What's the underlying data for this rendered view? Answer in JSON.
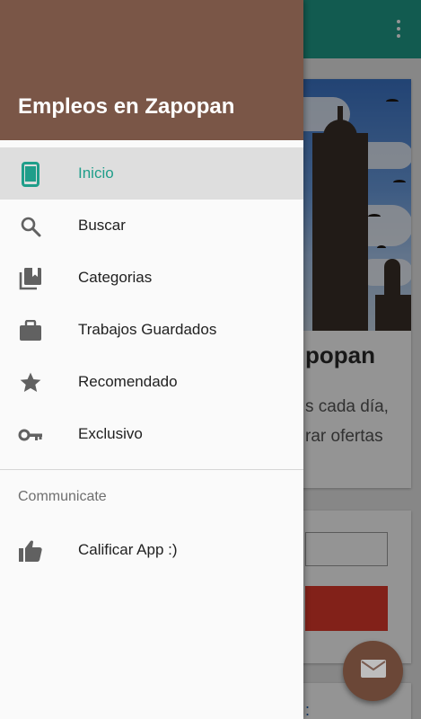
{
  "background": {
    "hero_title": "popan",
    "hero_line_1": "s cada día,",
    "hero_line_2": "rar ofertas",
    "bottom_link": ":",
    "accent_color": "#1f9e8a",
    "button_color": "#e0392b"
  },
  "drawer": {
    "title": "Empleos en Zapopan",
    "header_color": "#7a5647",
    "items": [
      {
        "label": "Inicio",
        "icon": "phone-icon",
        "active": true
      },
      {
        "label": "Buscar",
        "icon": "search-icon",
        "active": false
      },
      {
        "label": "Categorias",
        "icon": "bookmarks-icon",
        "active": false
      },
      {
        "label": "Trabajos Guardados",
        "icon": "briefcase-icon",
        "active": false
      },
      {
        "label": "Recomendado",
        "icon": "star-icon",
        "active": false
      },
      {
        "label": "Exclusivo",
        "icon": "key-icon",
        "active": false
      }
    ],
    "section_label": "Communicate",
    "rate_item": {
      "label": "Calificar App :)",
      "icon": "thumbs-up-icon"
    }
  },
  "fab": {
    "icon": "mail-icon",
    "color": "#6b4737"
  }
}
